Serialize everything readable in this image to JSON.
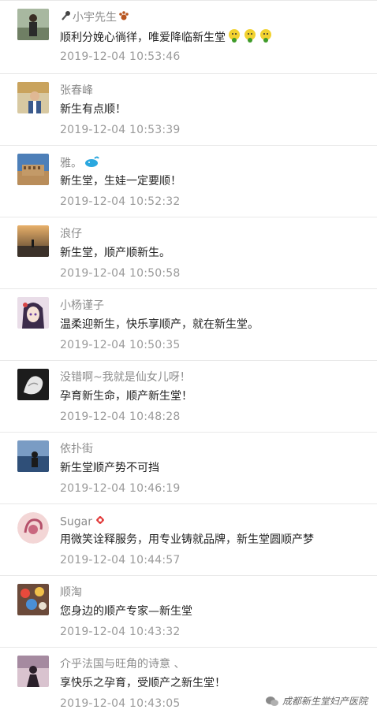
{
  "comments": [
    {
      "name": "小宇先生",
      "message": "顺利分娩心徜徉，唯爱降临新生堂",
      "time": "2019-12-04 10:53:46"
    },
    {
      "name": "张春峰",
      "message": "新生有点顺！",
      "time": "2019-12-04 10:53:39"
    },
    {
      "name": "雅。",
      "message": "新生堂，生娃一定要顺！",
      "time": "2019-12-04 10:52:32"
    },
    {
      "name": "浪仔",
      "message": "新生堂，顺产顺新生。",
      "time": "2019-12-04 10:50:58"
    },
    {
      "name": "小杨谨子",
      "message": "温柔迎新生，快乐享顺产，就在新生堂。",
      "time": "2019-12-04 10:50:35"
    },
    {
      "name": "没错啊~我就是仙女儿呀！",
      "message": "孕育新生命，顺产新生堂！",
      "time": "2019-12-04 10:48:28"
    },
    {
      "name": "依扑街",
      "message": "新生堂顺产势不可挡",
      "time": "2019-12-04 10:46:19"
    },
    {
      "name": "Sugar",
      "message": "用微笑诠释服务，用专业铸就品牌，新生堂圆顺产梦",
      "time": "2019-12-04 10:44:57"
    },
    {
      "name": "顺淘",
      "message": "您身边的顺产专家—新生堂",
      "time": "2019-12-04 10:43:32"
    },
    {
      "name": "介乎法国与旺角的诗意 、",
      "message": "享快乐之孕育，受顺产之新生堂！",
      "time": "2019-12-04 10:43:05"
    }
  ],
  "watermark": "成都新生堂妇产医院"
}
